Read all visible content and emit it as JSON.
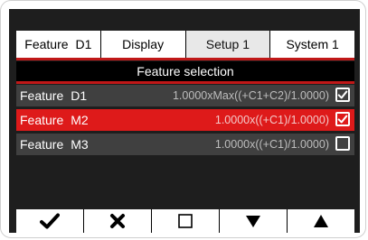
{
  "tabs": [
    {
      "label": "Feature",
      "suffix": "D1",
      "active": false
    },
    {
      "label": "Display",
      "suffix": "",
      "active": false
    },
    {
      "label": "Setup 1",
      "suffix": "",
      "active": true
    },
    {
      "label": "System 1",
      "suffix": "",
      "active": false
    }
  ],
  "section": {
    "title": "Feature selection"
  },
  "rows": [
    {
      "label": "Feature",
      "num": "D1",
      "formula": "1.0000xMax((+C1+C2)/1.0000)",
      "checked": true,
      "selected": false
    },
    {
      "label": "Feature",
      "num": "M2",
      "formula": "1.0000x((+C1)/1.0000)",
      "checked": true,
      "selected": true
    },
    {
      "label": "Feature",
      "num": "M3",
      "formula": "1.0000x((+C1)/1.0000)",
      "checked": false,
      "selected": false
    }
  ],
  "toolbar": {
    "icons": [
      "check-icon",
      "cross-icon",
      "square-icon",
      "down-triangle-icon",
      "up-triangle-icon"
    ]
  },
  "colors": {
    "accent": "#c01818",
    "selected_row": "#de1a1a",
    "row": "#404040",
    "screen_bg": "#1e1e1e"
  }
}
